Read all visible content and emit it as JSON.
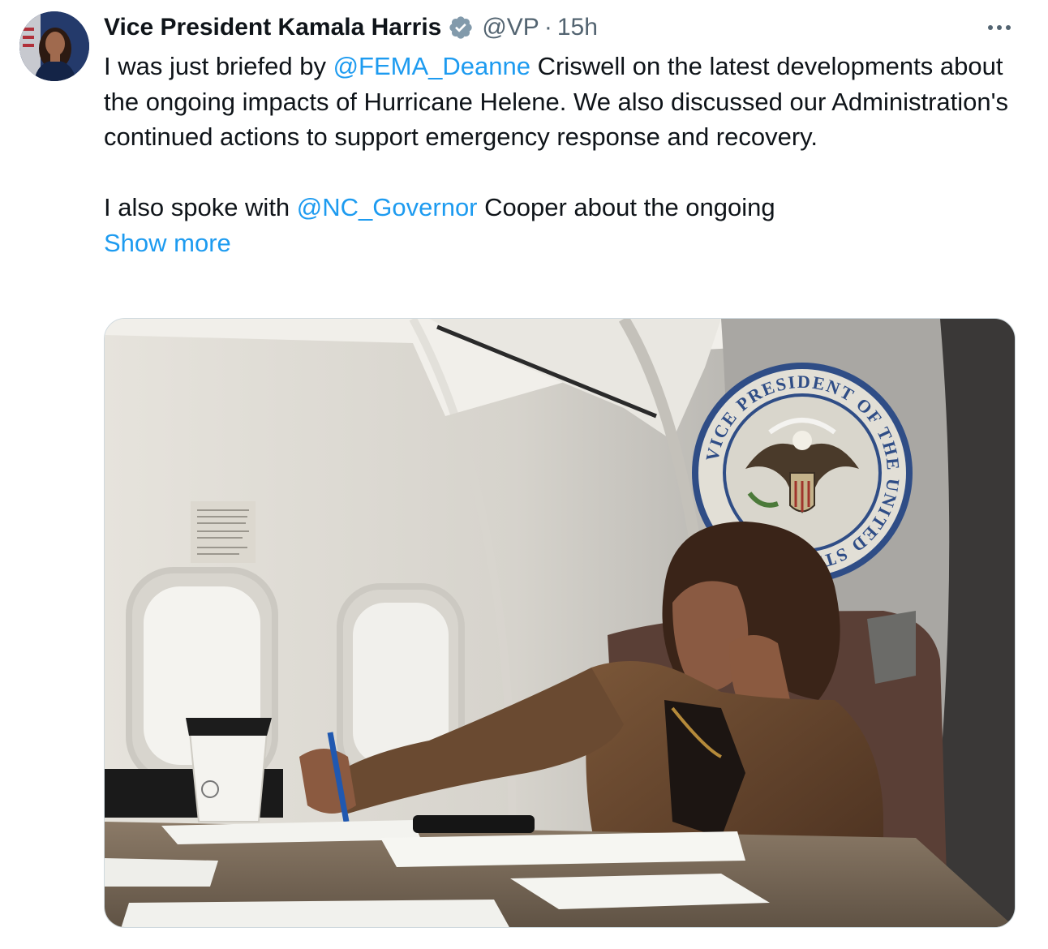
{
  "tweet": {
    "author_name": "Vice President Kamala Harris",
    "handle": "@VP",
    "separator": "·",
    "time": "15h",
    "paragraph1": {
      "before": "I was just briefed by ",
      "mention": "@FEMA_Deanne",
      "after": " Criswell on the latest developments about the ongoing impacts of Hurricane Helene. We also discussed our Administration's continued actions to support emergency response and recovery."
    },
    "paragraph2": {
      "before": "I also spoke with ",
      "mention": "@NC_Governor",
      "after": " Cooper about the ongoing"
    },
    "show_more": "Show more"
  },
  "media": {
    "seal_text": "VICE PRESIDENT OF THE UNITED STATES"
  },
  "icons": {
    "verified": "verified-badge-icon",
    "more": "more-options-icon"
  },
  "colors": {
    "link": "#1d9bf0",
    "secondary_text": "#536471",
    "verified_badge": "#829aab"
  }
}
